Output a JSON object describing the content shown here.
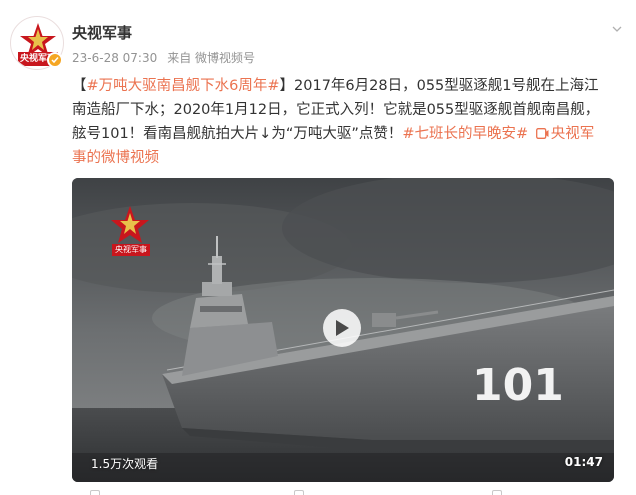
{
  "account": {
    "name": "央视军事",
    "avatar_label": "央视军事",
    "verified_color": "#f5a623",
    "brand_color": "#c8161d"
  },
  "meta": {
    "time": "23-6-28 07:30",
    "source": "来自 微博视频号"
  },
  "post": {
    "line1_prefix": "【",
    "topic1": "#万吨大驱南昌舰下水6周年#",
    "line1_rest": "】2017年6月28日，055型驱逐舰1号舰在上海江",
    "line2": "南造船厂下水；2020年1月12日，它正式入列！它就是055型驱逐舰首舰南昌舰，",
    "line3_text": "舷号101！看南昌舰航拍大片↓为“万吨大驱”点赞！",
    "topic2": "#七班长的早晚安#",
    "link_icon": "video-link-icon",
    "link_part1": "央视军",
    "line4_link": "事的微博视频",
    "accent_color": "#eb7350"
  },
  "video": {
    "watermark_label": "央视军事",
    "hull_number": "101",
    "views": "1.5万次观看",
    "duration": "01:47"
  }
}
